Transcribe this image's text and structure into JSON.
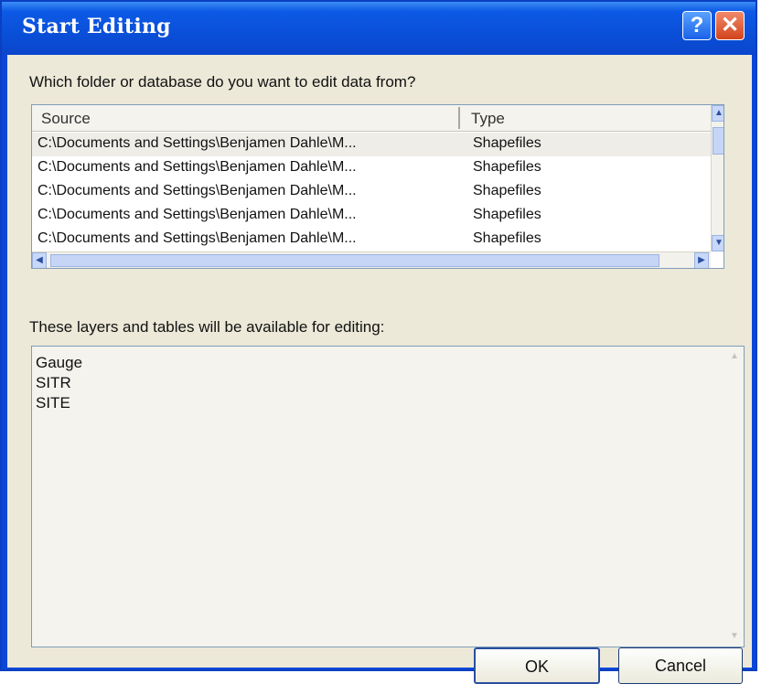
{
  "window": {
    "title": "Start Editing",
    "help_glyph": "?",
    "close_glyph": "✕"
  },
  "source_prompt": "Which folder or database do you want to edit data from?",
  "source_list": {
    "columns": [
      "Source",
      "Type"
    ],
    "rows": [
      {
        "source": "C:\\Documents and Settings\\Benjamen Dahle\\M...",
        "type": "Shapefiles"
      },
      {
        "source": "C:\\Documents and Settings\\Benjamen Dahle\\M...",
        "type": "Shapefiles"
      },
      {
        "source": "C:\\Documents and Settings\\Benjamen Dahle\\M...",
        "type": "Shapefiles"
      },
      {
        "source": "C:\\Documents and Settings\\Benjamen Dahle\\M...",
        "type": "Shapefiles"
      },
      {
        "source": "C:\\Documents and Settings\\Benjamen Dahle\\M...",
        "type": "Shapefiles"
      }
    ]
  },
  "layers_prompt": "These layers and tables will be available for editing:",
  "layers": [
    "Gauge",
    "SITR",
    "SITE"
  ],
  "buttons": {
    "ok": "OK",
    "cancel": "Cancel"
  },
  "icons": {
    "scroll_up": "▲",
    "scroll_down": "▼",
    "scroll_left": "◀",
    "scroll_right": "▶"
  }
}
